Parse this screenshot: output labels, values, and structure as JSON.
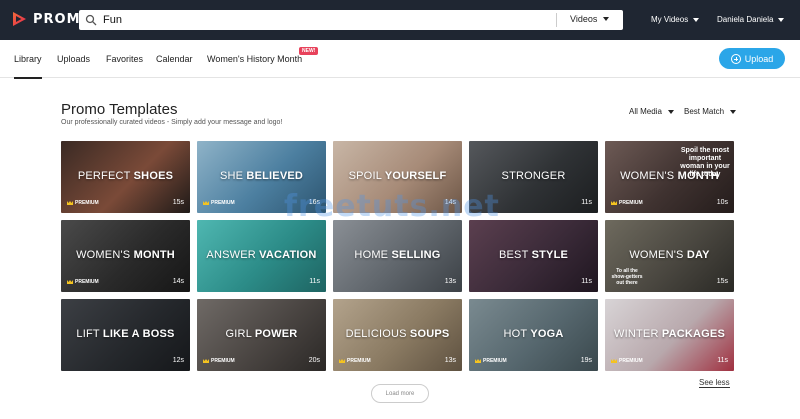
{
  "header": {
    "logo_text": "PROMO",
    "search": {
      "value": "Fun",
      "scope": "Videos"
    },
    "my_videos": "My Videos",
    "user_name": "Daniela Daniela"
  },
  "tabs": [
    {
      "label": "Library",
      "active": true
    },
    {
      "label": "Uploads"
    },
    {
      "label": "Favorites"
    },
    {
      "label": "Calendar"
    },
    {
      "label": "Women's History Month",
      "badge": "NEW!"
    }
  ],
  "upload_label": "Upload",
  "section": {
    "title": "Promo Templates",
    "subtitle": "Our professionally curated videos - Simply add your message and logo!",
    "filter_media": "All Media",
    "filter_sort": "Best Match"
  },
  "cards": [
    {
      "light": "PERFECT",
      "bold": "SHOES",
      "premium": "PREMIUM",
      "duration": "15s",
      "colors": [
        "#3a2a24",
        "#7a4a38",
        "#1f1a18"
      ]
    },
    {
      "light": "SHE",
      "bold": "BELIEVED",
      "premium": "PREMIUM",
      "duration": "16s",
      "colors": [
        "#8fb3c8",
        "#4c7fa0",
        "#2d5570"
      ]
    },
    {
      "light": "SPOIL",
      "bold": "YOURSELF",
      "premium": "",
      "duration": "14s",
      "colors": [
        "#c8b6a6",
        "#a78b78",
        "#6d5646"
      ]
    },
    {
      "light": "STRONGER",
      "bold": "",
      "premium": "",
      "duration": "11s",
      "colors": [
        "#55585c",
        "#2f3235",
        "#1c1e20"
      ]
    },
    {
      "light": "WOMEN'S",
      "bold": "MONTH",
      "premium": "PREMIUM",
      "duration": "10s",
      "colors": [
        "#6d5a55",
        "#3f3230",
        "#241c1b"
      ],
      "overlay": "Spoil the most important woman in your life today"
    },
    {
      "light": "WOMEN'S",
      "bold": "MONTH",
      "premium": "PREMIUM",
      "duration": "14s",
      "colors": [
        "#4a4a4a",
        "#2a2a2a",
        "#161616"
      ]
    },
    {
      "light": "ANSWER",
      "bold": "VACATION",
      "premium": "",
      "duration": "11s",
      "colors": [
        "#4fb7b1",
        "#2c8c88",
        "#1e6462"
      ]
    },
    {
      "light": "HOME",
      "bold": "SELLING",
      "premium": "",
      "duration": "13s",
      "colors": [
        "#8a8f95",
        "#5f656b",
        "#3c4146"
      ]
    },
    {
      "light": "BEST",
      "bold": "STYLE",
      "premium": "",
      "duration": "11s",
      "colors": [
        "#5b3f4f",
        "#3a2a38",
        "#1f1620"
      ]
    },
    {
      "light": "WOMEN'S",
      "bold": "DAY",
      "premium": "",
      "duration": "15s",
      "colors": [
        "#6e6a5e",
        "#4a4740",
        "#2a2925"
      ],
      "overlay": "To all the show-getters out there"
    },
    {
      "light": "LIFT",
      "bold": "LIKE A BOSS",
      "premium": "",
      "duration": "12s",
      "colors": [
        "#3c3f44",
        "#25282c",
        "#15171a"
      ]
    },
    {
      "light": "GIRL",
      "bold": "POWER",
      "premium": "PREMIUM",
      "duration": "20s",
      "colors": [
        "#6f6a66",
        "#4a4542",
        "#2b2826"
      ]
    },
    {
      "light": "DELICIOUS",
      "bold": "SOUPS",
      "premium": "PREMIUM",
      "duration": "13s",
      "colors": [
        "#b3a38c",
        "#8a7a62",
        "#5e5140"
      ]
    },
    {
      "light": "HOT",
      "bold": "YOGA",
      "premium": "PREMIUM",
      "duration": "19s",
      "colors": [
        "#7a8a90",
        "#56676e",
        "#3a484d"
      ]
    },
    {
      "light": "WINTER",
      "bold": "PACKAGES",
      "premium": "PREMIUM",
      "duration": "11s",
      "colors": [
        "#d8d4d6",
        "#b8a8ac",
        "#a03040"
      ]
    }
  ],
  "load_more": "Load more",
  "see_less": "See less",
  "watermark": "freetuts.net"
}
